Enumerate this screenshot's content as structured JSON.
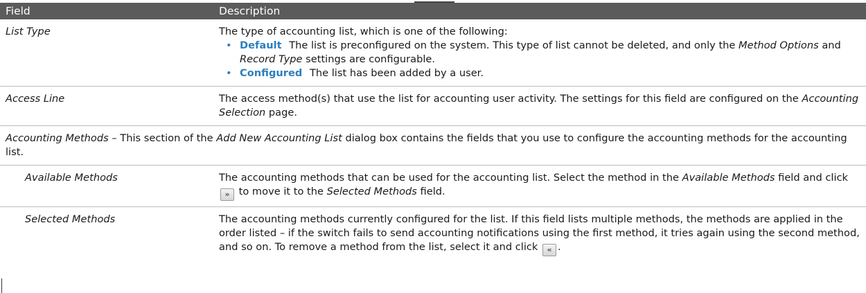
{
  "table": {
    "header": {
      "field": "Field",
      "description": "Description"
    },
    "list_type": {
      "field": "List Type",
      "intro": "The type of accounting list, which is one of the following:",
      "items": [
        {
          "term": "Default",
          "text_1": "The list is preconfigured on the system. This type of list cannot be deleted, and only the",
          "em_1": "Method Options",
          "text_2": "and",
          "em_2": "Record Type",
          "text_3": "settings are configurable."
        },
        {
          "term": "Configured",
          "text_1": "The list has been added by a user."
        }
      ]
    },
    "access_line": {
      "field": "Access Line",
      "text_1": "The access method(s) that use the list for accounting user activity. The settings for this field are configured on the",
      "em_1": "Accounting Selection",
      "text_2": "page."
    },
    "accounting_methods": {
      "em_1": "Accounting Methods",
      "text_1": "– This section of the",
      "em_2": "Add New Accounting List",
      "text_2": "dialog box contains the fields that you use to configure the accounting methods for the accounting list."
    },
    "available_methods": {
      "field": "Available Methods",
      "text_1": "The accounting methods that can be used for the accounting list. Select the method in the",
      "em_1": "Available Methods",
      "text_2": "field and click",
      "icon": "move-right-icon",
      "icon_glyph": "»",
      "text_3": "to move it to the",
      "em_2": "Selected Methods",
      "text_4": "field."
    },
    "selected_methods": {
      "field": "Selected Methods",
      "text_1": "The accounting methods currently configured for the list. If this field lists multiple methods, the methods are applied in the order listed – if the switch fails to send accounting notifications using the first method, it tries again using the second method, and so on. To remove a method from the list, select it and click",
      "icon": "move-left-icon",
      "icon_glyph": "«",
      "text_2": "."
    }
  },
  "colors": {
    "header_bg": "#5b5b5b",
    "term": "#2c7fbf",
    "rule": "#bdbdbd"
  }
}
